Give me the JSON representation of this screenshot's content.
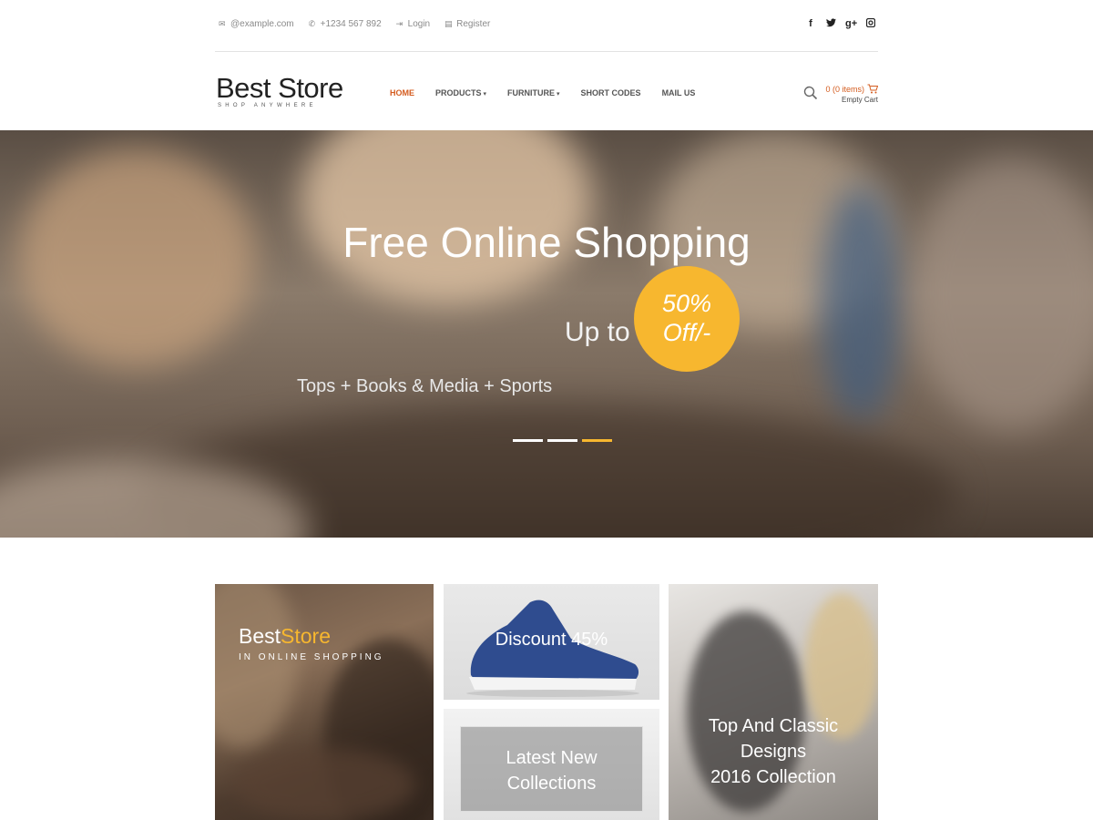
{
  "topbar": {
    "email": "@example.com",
    "phone": "+1234 567 892",
    "login": "Login",
    "register": "Register",
    "social": [
      "f",
      "t",
      "g+",
      "ig"
    ]
  },
  "header": {
    "logo_title": "Best Store",
    "logo_sub": "SHOP ANYWHERE",
    "nav": [
      {
        "label": "HOME",
        "active": true
      },
      {
        "label": "PRODUCTS",
        "dropdown": true
      },
      {
        "label": "FURNITURE",
        "dropdown": true
      },
      {
        "label": "SHORT CODES"
      },
      {
        "label": "MAIL US"
      }
    ],
    "cart_items": "0 (0 items)",
    "cart_status": "Empty Cart"
  },
  "hero": {
    "title": "Free Online Shopping",
    "upto": "Up to",
    "badge_line1": "50%",
    "badge_line2": "Off/-",
    "tags": "Tops + Books & Media + Sports",
    "slides": 3,
    "active_slide": 3
  },
  "tiles": {
    "brand_part1": "Best",
    "brand_part2": "Store",
    "brand_tag": "IN ONLINE SHOPPING",
    "discount": "Discount 45%",
    "collections_line1": "Latest New",
    "collections_line2": "Collections",
    "classic_line1": "Top And Classic",
    "classic_line2": "Designs",
    "classic_line3": "2016 Collection"
  },
  "colors": {
    "accent": "#d45c1f",
    "badge": "#f7b72f"
  }
}
